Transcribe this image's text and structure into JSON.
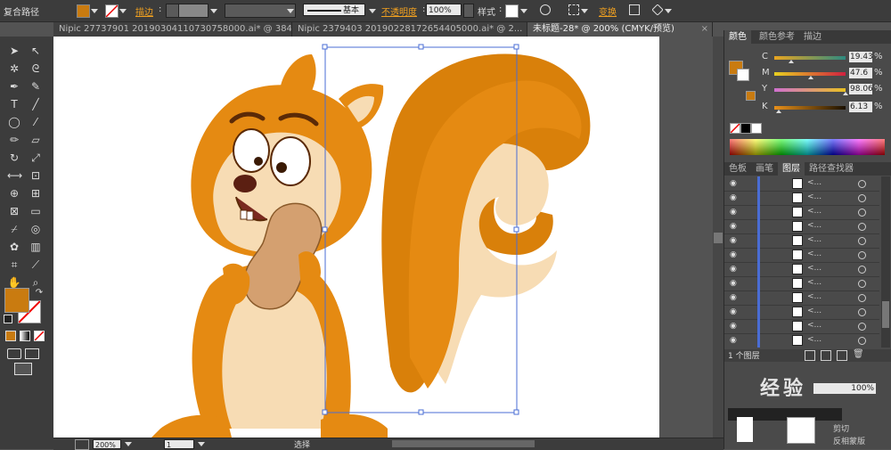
{
  "control_bar": {
    "object_type": "复合路径",
    "fill_color": "#c97b10",
    "stroke_label": "描边",
    "stroke_style": "基本",
    "opacity_label": "不透明度",
    "opacity_value": "100%",
    "style_label": "样式",
    "transform_label": "变换"
  },
  "tabs": [
    {
      "label": "Nipic 27737901 20190304110730758000.ai* @ 384...",
      "active": false
    },
    {
      "label": "Nipic 2379403 20190228172654405000.ai* @ 2...",
      "active": false
    },
    {
      "label": "未标题-28* @ 200% (CMYK/预览)",
      "active": true
    }
  ],
  "color_panel": {
    "tabs": [
      "颜色",
      "颜色参考",
      "描边"
    ],
    "channels": [
      {
        "label": "C",
        "value": "19.43",
        "unit": "%",
        "level": 0.19
      },
      {
        "label": "M",
        "value": "47.6",
        "unit": "%",
        "level": 0.48
      },
      {
        "label": "Y",
        "value": "98.06",
        "unit": "%",
        "level": 0.98
      },
      {
        "label": "K",
        "value": "6.13",
        "unit": "%",
        "level": 0.06
      }
    ]
  },
  "layers_panel": {
    "tabs": [
      "色板",
      "画笔",
      "图层",
      "路径查找器"
    ],
    "rows": 12,
    "footer": "1 个图层"
  },
  "status_bar": {
    "zoom": "200%",
    "page": "1",
    "tool": "选择"
  },
  "watermark": {
    "text": "经验",
    "option_lines": [
      "剪切",
      "反相蒙版"
    ]
  },
  "colors": {
    "squirrel_orange": "#e58a12",
    "squirrel_cream": "#f7dcb4",
    "selection_blue": "#4a6dd4"
  }
}
